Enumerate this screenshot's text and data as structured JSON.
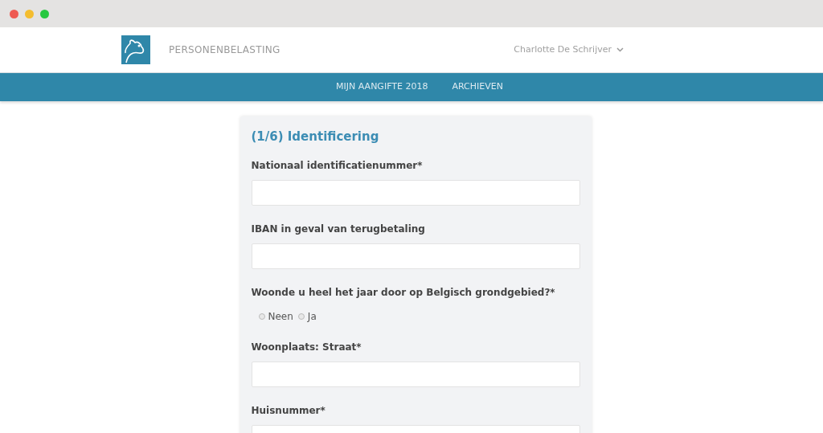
{
  "header": {
    "app_name": "PERSONENBELASTING",
    "user": "Charlotte De Schrijver"
  },
  "nav": [
    {
      "label": "MIJN AANGIFTE 2018",
      "selected": false
    },
    {
      "label": "ARCHIEVEN",
      "selected": false
    }
  ],
  "form": {
    "title": "(1/6) Identificering",
    "fields": [
      {
        "kind": "text",
        "label": "Nationaal identificatienummer*"
      },
      {
        "kind": "text",
        "label": "IBAN in geval van terugbetaling"
      },
      {
        "kind": "radio",
        "label": "Woonde u heel het jaar door op Belgisch grondgebied?*",
        "options": [
          {
            "label": "Neen",
            "selected": false
          },
          {
            "label": "Ja",
            "selected": false
          }
        ]
      },
      {
        "kind": "text",
        "label": "Woonplaats: Straat*"
      },
      {
        "kind": "text",
        "label": "Huisnummer*"
      }
    ]
  }
}
